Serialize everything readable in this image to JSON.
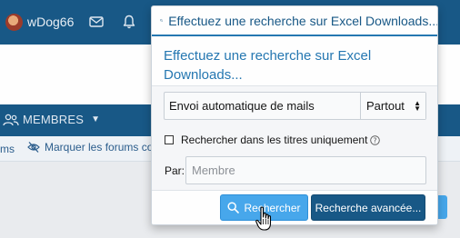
{
  "header": {
    "username": "wDog66",
    "icons": [
      "avatar",
      "mail-icon",
      "bell-icon"
    ]
  },
  "nav": {
    "members_label": "MEMBRES",
    "members_icon": "users-icon"
  },
  "subnav": {
    "truncated_link": "ms",
    "mark_read_label": "Marquer les forums com",
    "mark_read_icon": "eye-slash-icon"
  },
  "search_popup": {
    "header_query": "Effectuez une recherche sur Excel Downloads...",
    "title": "Effectuez une recherche sur Excel Downloads...",
    "keyword_value": "Envoi automatique de mails",
    "scope_value": "Partout",
    "titles_only_label": "Rechercher dans les titres uniquement",
    "titles_only_checked": false,
    "by_label": "Par:",
    "member_placeholder": "Membre",
    "search_button": "Rechercher",
    "advanced_button": "Recherche avancée..."
  },
  "colors": {
    "header_blue": "#185886",
    "accent_blue": "#2577b1",
    "button_light_blue": "#47a7eb"
  }
}
